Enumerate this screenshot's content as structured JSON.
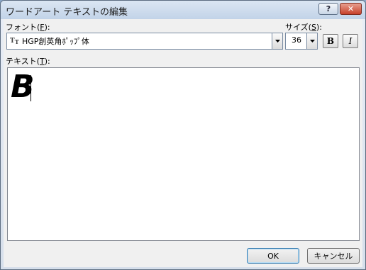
{
  "window": {
    "title": "ワードアート テキストの編集"
  },
  "titlebar": {
    "help_label": "?",
    "close_label": "✕"
  },
  "font": {
    "label_pre": "フォント(",
    "label_key": "F",
    "label_post": "):",
    "value": "HGP創英角ﾎﾟｯﾌﾟ体",
    "icon_text": "T"
  },
  "size": {
    "label_pre": "サイズ(",
    "label_key": "S",
    "label_post": "):",
    "value": "36"
  },
  "format": {
    "bold_label": "B",
    "italic_label": "I"
  },
  "text": {
    "label_pre": "テキスト(",
    "label_key": "T",
    "label_post": "):",
    "value": "B"
  },
  "buttons": {
    "ok": "OK",
    "cancel": "キャンセル"
  },
  "colors": {
    "title_bg": "#c2d3e8",
    "close_red": "#c7402a",
    "dialog_bg": "#f0f0f0"
  }
}
